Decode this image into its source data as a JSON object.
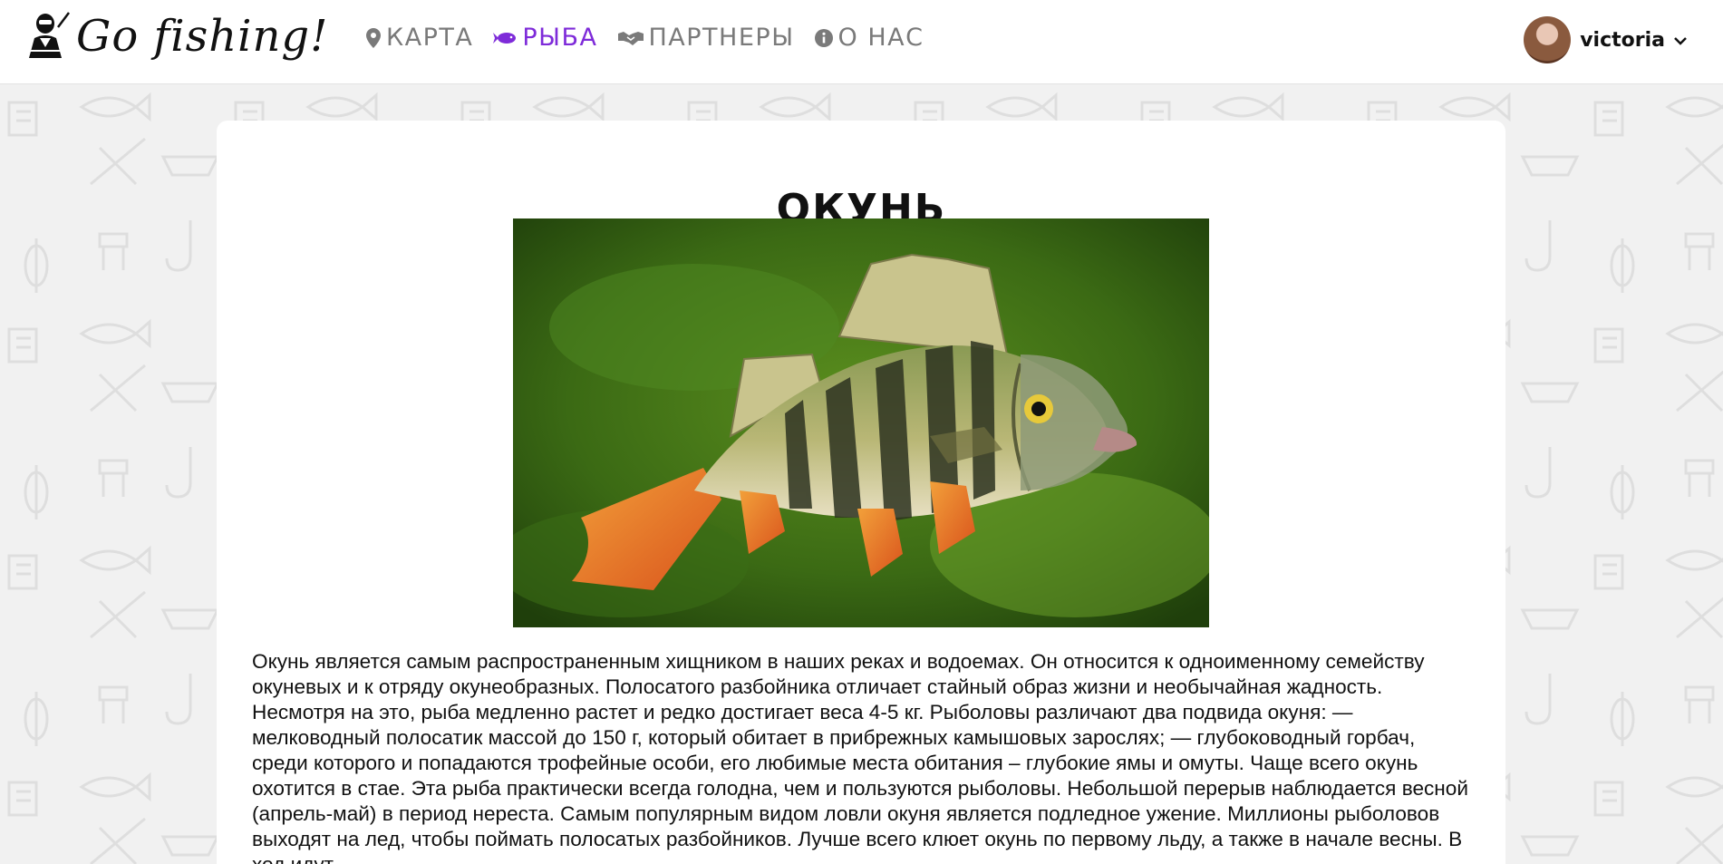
{
  "brand": {
    "name": "Go fishing!",
    "icon": "fisherman-icon"
  },
  "nav": {
    "items": [
      {
        "label": "КАРТА",
        "icon": "map-marker-icon",
        "active": false
      },
      {
        "label": "РЫБА",
        "icon": "fish-icon",
        "active": true
      },
      {
        "label": "ПАРТНЕРЫ",
        "icon": "handshake-icon",
        "active": false
      },
      {
        "label": "О НАС",
        "icon": "info-circle-icon",
        "active": false
      }
    ]
  },
  "user": {
    "name": "victoria",
    "icon": "chevron-down-icon"
  },
  "colors": {
    "accent": "#7e2bd9",
    "nav_inactive": "#7a7a7a",
    "page_background": "#f1f1f1"
  },
  "fish": {
    "title": "ОКУНЬ",
    "description": "Окунь является самым распространенным хищником в наших реках и водоемах. Он относится к одноименному семейству окуневых и к отряду окунеобразных. Полосатого разбойника отличает стайный образ жизни и необычайная жадность. Несмотря на это, рыба медленно растет и редко достигает веса 4-5 кг. Рыболовы различают два подвида окуня: — мелководный полосатик массой до 150 г, который обитает в прибрежных камышовых зарослях; — глубоководный горбач, среди которого и попадаются трофейные особи, его любимые места обитания – глубокие ямы и омуты. Чаще всего окунь охотится в стае. Эта рыба практически всегда голодна, чем и пользуются рыболовы. Небольшой перерыв наблюдается весной (апрель-май) в период нереста. Самым популярным видом ловли окуня является подледное ужение. Миллионы рыболовов выходят на лед, чтобы поймать полосатых разбойников. Лучше всего клюет окунь по первому льду, а также в начале весны. В ход идут"
  }
}
